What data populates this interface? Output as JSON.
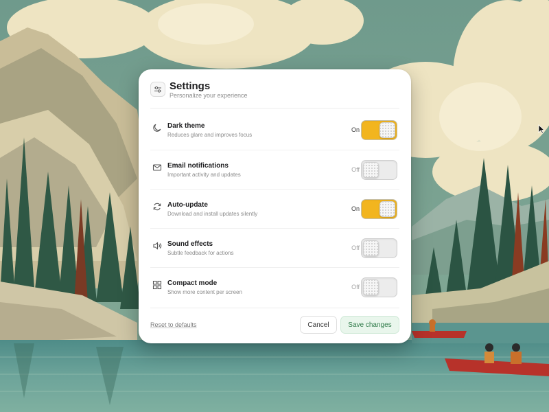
{
  "dialog": {
    "title": "Settings",
    "subtitle": "Personalize your experience",
    "header_icon": "sliders-icon"
  },
  "settings": [
    {
      "label": "Dark theme",
      "description": "Reduces glare and improves focus",
      "state": "On",
      "enabled": true,
      "icon": "moon-icon"
    },
    {
      "label": "Email notifications",
      "description": "Important activity and updates",
      "state": "Off",
      "enabled": false,
      "icon": "mail-icon"
    },
    {
      "label": "Auto-update",
      "description": "Download and install updates silently",
      "state": "On",
      "enabled": true,
      "icon": "refresh-icon"
    },
    {
      "label": "Sound effects",
      "description": "Subtle feedback for actions",
      "state": "Off",
      "enabled": false,
      "icon": "speaker-icon"
    },
    {
      "label": "Compact mode",
      "description": "Show more content per screen",
      "state": "Off",
      "enabled": false,
      "icon": "grid-icon"
    }
  ],
  "footer": {
    "reset_label": "Reset to defaults",
    "cancel_label": "Cancel",
    "save_label": "Save changes"
  },
  "colors": {
    "toggle_on": "#f2b51f",
    "toggle_off": "#ececec",
    "save_bg": "#e9f6ec",
    "save_text": "#2f7a49"
  }
}
